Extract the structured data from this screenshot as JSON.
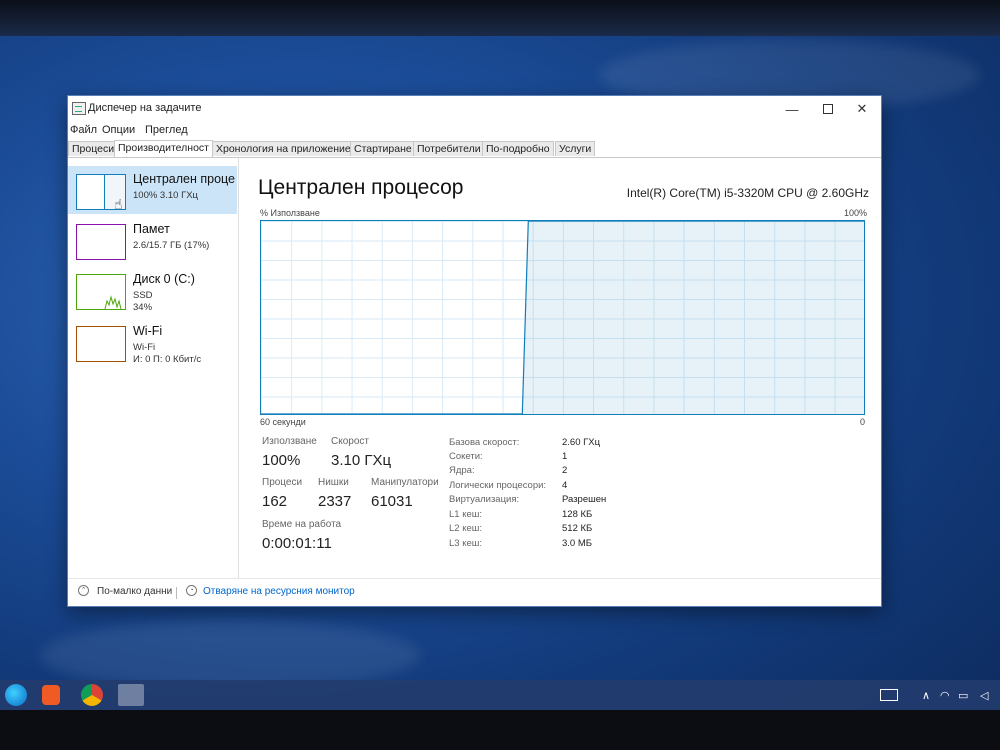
{
  "window": {
    "title": "Диспечер на задачите",
    "minimize_icon": "minimize-icon",
    "maximize_icon": "maximize-icon",
    "close_icon": "close-icon"
  },
  "menu": [
    "Файл",
    "Опции",
    "Преглед"
  ],
  "tabs": [
    "Процеси",
    "Производителност",
    "Хронология на приложение",
    "Стартиране",
    "Потребители",
    "По-подробно",
    "Услуги"
  ],
  "active_tab": "Производителност",
  "sidebar": [
    {
      "name": "Централен проце",
      "sub1": "100%  3.10 ГХц",
      "sub2": "",
      "sub3": ""
    },
    {
      "name": "Памет",
      "sub1": "2.6/15.7 ГБ (17%)",
      "sub2": "",
      "sub3": ""
    },
    {
      "name": "Диск 0 (C:)",
      "sub1": "SSD",
      "sub2": "34%",
      "sub3": ""
    },
    {
      "name": "Wi-Fi",
      "sub1": "Wi-Fi",
      "sub2": "И: 0 П: 0 Кбит/с",
      "sub3": ""
    }
  ],
  "main": {
    "title": "Централен процесор",
    "cpu_model": "Intel(R) Core(TM) i5-3320M CPU @ 2.60GHz",
    "graph_ylabel": "% Използване",
    "graph_ymax": "100%",
    "graph_xleft": "60 секунди",
    "graph_xright": "0"
  },
  "chart_data": {
    "type": "area",
    "x": [
      60,
      56,
      52,
      48,
      44,
      40,
      36,
      34,
      33.4,
      0
    ],
    "values": [
      0,
      0,
      0,
      0,
      0,
      0,
      0,
      0,
      100,
      100
    ],
    "ylabel": "% Използване",
    "ylim": [
      0,
      100
    ],
    "grid": true,
    "color": "#117dbb"
  },
  "stats": {
    "util_label": "Използване",
    "util_value": "100%",
    "speed_label": "Скорост",
    "speed_value": "3.10 ГХц",
    "proc_label": "Процеси",
    "proc_value": "162",
    "threads_label": "Нишки",
    "threads_value": "2337",
    "handles_label": "Манипулатори",
    "handles_value": "61031",
    "uptime_label": "Време на работа",
    "uptime_value": "0:00:01:11"
  },
  "specs": [
    {
      "label": "Базова скорост:",
      "value": "2.60 ГХц"
    },
    {
      "label": "Сокети:",
      "value": "1"
    },
    {
      "label": "Ядра:",
      "value": "2"
    },
    {
      "label": "Логически процесори:",
      "value": "4"
    },
    {
      "label": "Виртуализация:",
      "value": "Разрешен"
    },
    {
      "label": "L1 кеш:",
      "value": "128 КБ"
    },
    {
      "label": "L2 кеш:",
      "value": "512 КБ"
    },
    {
      "label": "L3 кеш:",
      "value": "3.0 МБ"
    }
  ],
  "footer": {
    "fewer_details": "По-малко данни",
    "resource_monitor": "Отваряне на ресурсния монитор"
  },
  "colors": {
    "cpu": "#117dbb",
    "memory": "#8b12ae",
    "disk": "#4da60c",
    "wifi": "#a74f01",
    "selected": "#cce4f7"
  }
}
